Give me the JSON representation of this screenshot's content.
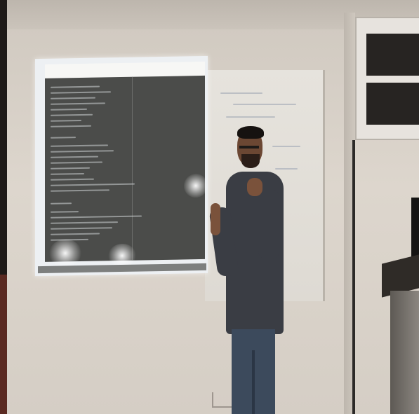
{
  "scene": {
    "screen_content_legible": false,
    "colors": {
      "wall": "#d8d1c9",
      "editor_background": "#4b4c4a",
      "shirt": "#3a3d44",
      "jeans": "#3c4a5c",
      "skin": "#6b4733"
    },
    "elements": [
      "projected-code-editor",
      "whiteboard",
      "presenter",
      "wall-cabinet",
      "podium"
    ]
  }
}
